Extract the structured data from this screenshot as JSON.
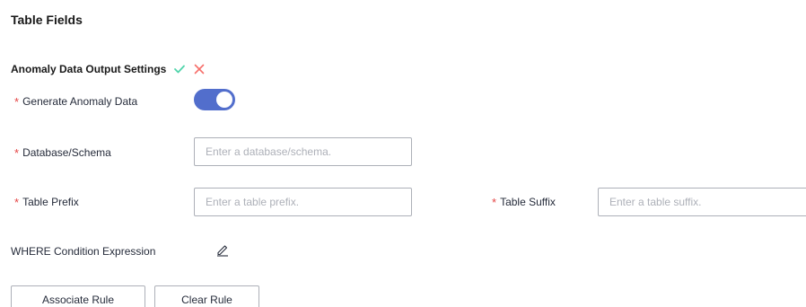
{
  "section": {
    "title": "Table Fields"
  },
  "anomaly": {
    "title": "Anomaly Data Output Settings",
    "confirm_icon": "check-icon",
    "cancel_icon": "close-icon"
  },
  "fields": {
    "required_mark": "*",
    "generate_anomaly_label": "Generate Anomaly Data",
    "generate_anomaly_on": true,
    "database_label": "Database/Schema",
    "database_placeholder": "Enter a database/schema.",
    "database_value": "",
    "prefix_label": "Table Prefix",
    "prefix_placeholder": "Enter a table prefix.",
    "prefix_value": "",
    "suffix_label": "Table Suffix",
    "suffix_placeholder": "Enter a table suffix.",
    "suffix_value": "",
    "where_label": "WHERE Condition Expression",
    "where_edit_icon": "pencil-icon"
  },
  "actions": {
    "associate_label": "Associate Rule",
    "clear_label": "Clear Rule"
  },
  "colors": {
    "accent": "#526ecc",
    "required": "#e54545",
    "confirm": "#50d4ab",
    "cancel": "#f66f6a"
  }
}
